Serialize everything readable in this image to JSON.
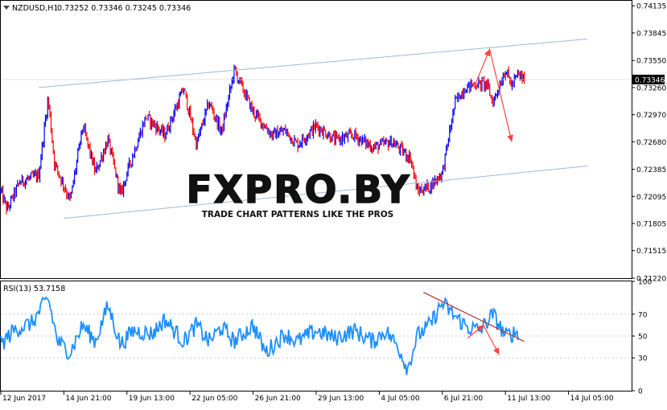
{
  "header": {
    "symbol": "NZDUSD,H1",
    "ohlc": "0.73252 0.73346 0.73245 0.73346",
    "rsi_label": "RSI(13) 53.7158"
  },
  "watermark": {
    "brand": "FXPRO.BY",
    "tagline": "TRADE CHART PATTERNS LIKE THE PROS"
  },
  "colors": {
    "background": "#ffffff",
    "frame": "#000000",
    "bull": "#0000ff",
    "bear": "#ff0000",
    "rsi_line": "#1e90ff",
    "channel": "#9fb8d0",
    "arrow": "#ff4040",
    "trendline": "#b03030",
    "grid": "#c8c8c8"
  },
  "chart_data": [
    {
      "type": "candlestick",
      "title": "NZDUSD,H1",
      "ylim": [
        0.7122,
        0.7418
      ],
      "y_ticks": [
        "0.74135",
        "0.73845",
        "0.73550",
        "0.73260",
        "0.72970",
        "0.72680",
        "0.72385",
        "0.72095",
        "0.71805",
        "0.71515",
        "0.71220"
      ],
      "current_price_label": "0.73346",
      "current_price": 0.73346,
      "series_sketch": {
        "x": [
          0,
          0.01,
          0.03,
          0.06,
          0.075,
          0.085,
          0.11,
          0.13,
          0.15,
          0.17,
          0.19,
          0.2,
          0.23,
          0.26,
          0.29,
          0.31,
          0.33,
          0.35,
          0.37,
          0.4,
          0.43,
          0.45,
          0.47,
          0.5,
          0.53,
          0.56,
          0.59,
          0.62,
          0.65,
          0.66,
          0.68,
          0.7,
          0.72,
          0.735,
          0.75,
          0.77,
          0.78,
          0.8,
          0.81,
          0.82,
          0.83
        ],
        "y": [
          0.7215,
          0.7195,
          0.7225,
          0.7232,
          0.7315,
          0.7245,
          0.7205,
          0.7285,
          0.7235,
          0.727,
          0.721,
          0.7235,
          0.7295,
          0.7275,
          0.7325,
          0.7265,
          0.731,
          0.7278,
          0.7345,
          0.73,
          0.7275,
          0.728,
          0.7265,
          0.7285,
          0.727,
          0.7275,
          0.7262,
          0.7268,
          0.725,
          0.7215,
          0.722,
          0.7235,
          0.731,
          0.7325,
          0.733,
          0.733,
          0.731,
          0.7345,
          0.7328,
          0.734,
          0.7334
        ]
      },
      "channel": {
        "upper": {
          "x": [
            0.06,
            0.93
          ],
          "y": [
            0.7326,
            0.7378
          ]
        },
        "lower": {
          "x": [
            0.1,
            0.93
          ],
          "y": [
            0.7186,
            0.7242
          ]
        }
      },
      "projection": {
        "x": [
          0.75,
          0.775,
          0.81
        ],
        "y": [
          0.7326,
          0.7367,
          0.7268
        ]
      }
    },
    {
      "type": "line",
      "title": "RSI(13) 53.7158",
      "ylim": [
        0,
        100
      ],
      "y_ticks": [
        "100",
        "70",
        "50",
        "30",
        "0"
      ],
      "levels": [
        70,
        50,
        30
      ],
      "series_sketch": {
        "x": [
          0,
          0.02,
          0.05,
          0.075,
          0.09,
          0.11,
          0.13,
          0.15,
          0.17,
          0.19,
          0.21,
          0.24,
          0.26,
          0.29,
          0.31,
          0.33,
          0.35,
          0.37,
          0.4,
          0.42,
          0.45,
          0.47,
          0.5,
          0.53,
          0.56,
          0.59,
          0.61,
          0.63,
          0.645,
          0.66,
          0.68,
          0.7,
          0.72,
          0.74,
          0.76,
          0.78,
          0.8,
          0.82
        ],
        "y": [
          42,
          55,
          62,
          85,
          45,
          35,
          60,
          45,
          78,
          42,
          55,
          52,
          65,
          45,
          60,
          45,
          58,
          45,
          60,
          35,
          52,
          45,
          55,
          48,
          55,
          45,
          55,
          40,
          20,
          50,
          60,
          80,
          68,
          58,
          55,
          70,
          50,
          54
        ]
      },
      "trendline": {
        "x": [
          0.67,
          0.83
        ],
        "y": [
          90,
          45
        ]
      },
      "projection": {
        "x": [
          0.74,
          0.765,
          0.79
        ],
        "y": [
          48,
          60,
          33
        ]
      }
    }
  ],
  "x_axis": {
    "labels": [
      "12 Jun 2017",
      "14 Jun 21:00",
      "19 Jun 13:00",
      "22 Jun 05:00",
      "26 Jun 21:00",
      "29 Jun 13:00",
      "4 Jul 05:00",
      "6 Jul 21:00",
      "11 Jul 13:00",
      "14 Jul 05:00"
    ],
    "positions": [
      0,
      0.1,
      0.2,
      0.3,
      0.4,
      0.5,
      0.6,
      0.7,
      0.8,
      0.9
    ]
  }
}
